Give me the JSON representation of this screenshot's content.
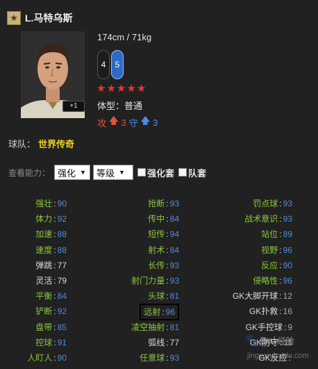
{
  "player": {
    "badge_icon": "star-badge-icon",
    "name": "L.马特乌斯",
    "height_weight": "174cm / 71kg",
    "weak_foot_left": "4",
    "weak_foot_right": "5",
    "stars": [
      "★",
      "★",
      "★",
      "★",
      "★"
    ],
    "plus_badge": "+1",
    "build_label": "体型：",
    "build_value": "普通",
    "attack_label": "攻",
    "attack_value": "3",
    "defense_label": "守",
    "defense_value": "3"
  },
  "team": {
    "label": "球队：",
    "value": "世界传奇"
  },
  "view": {
    "label": "查看能力：",
    "select1": "强化",
    "select2": "等级",
    "check1": "强化套",
    "check2": "队套"
  },
  "stats": {
    "rows": [
      [
        {
          "label": "强壮",
          "value": "90",
          "lc": "green",
          "vc": "blue"
        },
        {
          "label": "抢断",
          "value": "93",
          "lc": "green",
          "vc": "blue"
        },
        {
          "label": "罚点球",
          "value": "93",
          "lc": "green",
          "vc": "blue"
        }
      ],
      [
        {
          "label": "体力",
          "value": "92",
          "lc": "green",
          "vc": "blue"
        },
        {
          "label": "传中",
          "value": "84",
          "lc": "green",
          "vc": "blue"
        },
        {
          "label": "战术意识",
          "value": "93",
          "lc": "green",
          "vc": "blue"
        }
      ],
      [
        {
          "label": "加速",
          "value": "88",
          "lc": "green",
          "vc": "blue"
        },
        {
          "label": "短传",
          "value": "94",
          "lc": "green",
          "vc": "blue"
        },
        {
          "label": "站位",
          "value": "89",
          "lc": "green",
          "vc": "blue"
        }
      ],
      [
        {
          "label": "速度",
          "value": "88",
          "lc": "green",
          "vc": "blue"
        },
        {
          "label": "射术",
          "value": "84",
          "lc": "green",
          "vc": "blue"
        },
        {
          "label": "视野",
          "value": "96",
          "lc": "green",
          "vc": "blue"
        }
      ],
      [
        {
          "label": "弹跳",
          "value": "77",
          "lc": "white",
          "vc": "white"
        },
        {
          "label": "长传",
          "value": "93",
          "lc": "green",
          "vc": "blue"
        },
        {
          "label": "反应",
          "value": "90",
          "lc": "green",
          "vc": "blue"
        }
      ],
      [
        {
          "label": "灵活",
          "value": "79",
          "lc": "white",
          "vc": "white"
        },
        {
          "label": "射门力量",
          "value": "93",
          "lc": "green",
          "vc": "blue"
        },
        {
          "label": "侵略性",
          "value": "96",
          "lc": "green",
          "vc": "blue"
        }
      ],
      [
        {
          "label": "平衡",
          "value": "84",
          "lc": "green",
          "vc": "blue"
        },
        {
          "label": "头球",
          "value": "81",
          "lc": "green",
          "vc": "blue"
        },
        {
          "label": "GK大脚开球",
          "value": "12",
          "lc": "white",
          "vc": "gray"
        }
      ],
      [
        {
          "label": "铲断",
          "value": "92",
          "lc": "green",
          "vc": "blue"
        },
        {
          "label": "远射",
          "value": "96",
          "lc": "green",
          "vc": "blue",
          "boxed": true
        },
        {
          "label": "GK扑救",
          "value": "16",
          "lc": "white",
          "vc": "gray"
        }
      ],
      [
        {
          "label": "盘带",
          "value": "85",
          "lc": "green",
          "vc": "blue"
        },
        {
          "label": "凌空抽射",
          "value": "81",
          "lc": "green",
          "vc": "blue"
        },
        {
          "label": "GK手控球",
          "value": "9",
          "lc": "white",
          "vc": "gray"
        }
      ],
      [
        {
          "label": "控球",
          "value": "91",
          "lc": "green",
          "vc": "blue"
        },
        {
          "label": "弧线",
          "value": "77",
          "lc": "white",
          "vc": "white"
        },
        {
          "label": "GK防守",
          "value": "11",
          "lc": "white",
          "vc": "gray"
        }
      ],
      [
        {
          "label": "人盯人",
          "value": "90",
          "lc": "green",
          "vc": "blue"
        },
        {
          "label": "任意球",
          "value": "93",
          "lc": "green",
          "vc": "blue"
        },
        {
          "label": "GK反应",
          "value": "",
          "lc": "white",
          "vc": "gray"
        }
      ]
    ]
  },
  "watermark": {
    "text": "Bai",
    "text2": "经验",
    "sub": "jingyan.baidu.com"
  }
}
